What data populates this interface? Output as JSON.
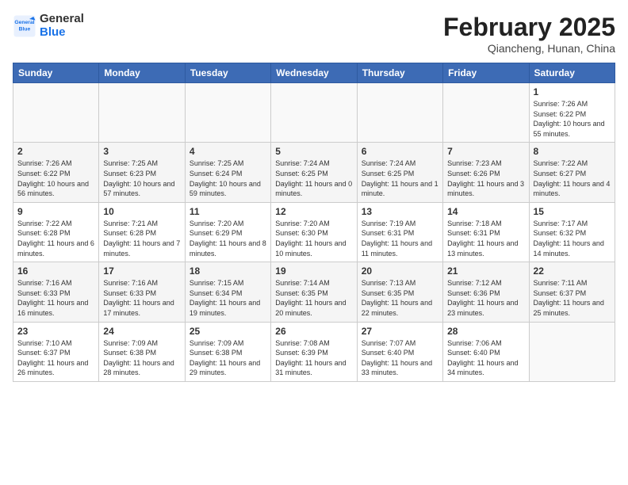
{
  "header": {
    "logo_line1": "General",
    "logo_line2": "Blue",
    "month_title": "February 2025",
    "location": "Qiancheng, Hunan, China"
  },
  "weekdays": [
    "Sunday",
    "Monday",
    "Tuesday",
    "Wednesday",
    "Thursday",
    "Friday",
    "Saturday"
  ],
  "weeks": [
    [
      {
        "day": "",
        "info": ""
      },
      {
        "day": "",
        "info": ""
      },
      {
        "day": "",
        "info": ""
      },
      {
        "day": "",
        "info": ""
      },
      {
        "day": "",
        "info": ""
      },
      {
        "day": "",
        "info": ""
      },
      {
        "day": "1",
        "info": "Sunrise: 7:26 AM\nSunset: 6:22 PM\nDaylight: 10 hours and 55 minutes."
      }
    ],
    [
      {
        "day": "2",
        "info": "Sunrise: 7:26 AM\nSunset: 6:22 PM\nDaylight: 10 hours and 56 minutes."
      },
      {
        "day": "3",
        "info": "Sunrise: 7:25 AM\nSunset: 6:23 PM\nDaylight: 10 hours and 57 minutes."
      },
      {
        "day": "4",
        "info": "Sunrise: 7:25 AM\nSunset: 6:24 PM\nDaylight: 10 hours and 59 minutes."
      },
      {
        "day": "5",
        "info": "Sunrise: 7:24 AM\nSunset: 6:25 PM\nDaylight: 11 hours and 0 minutes."
      },
      {
        "day": "6",
        "info": "Sunrise: 7:24 AM\nSunset: 6:25 PM\nDaylight: 11 hours and 1 minute."
      },
      {
        "day": "7",
        "info": "Sunrise: 7:23 AM\nSunset: 6:26 PM\nDaylight: 11 hours and 3 minutes."
      },
      {
        "day": "8",
        "info": "Sunrise: 7:22 AM\nSunset: 6:27 PM\nDaylight: 11 hours and 4 minutes."
      }
    ],
    [
      {
        "day": "9",
        "info": "Sunrise: 7:22 AM\nSunset: 6:28 PM\nDaylight: 11 hours and 6 minutes."
      },
      {
        "day": "10",
        "info": "Sunrise: 7:21 AM\nSunset: 6:28 PM\nDaylight: 11 hours and 7 minutes."
      },
      {
        "day": "11",
        "info": "Sunrise: 7:20 AM\nSunset: 6:29 PM\nDaylight: 11 hours and 8 minutes."
      },
      {
        "day": "12",
        "info": "Sunrise: 7:20 AM\nSunset: 6:30 PM\nDaylight: 11 hours and 10 minutes."
      },
      {
        "day": "13",
        "info": "Sunrise: 7:19 AM\nSunset: 6:31 PM\nDaylight: 11 hours and 11 minutes."
      },
      {
        "day": "14",
        "info": "Sunrise: 7:18 AM\nSunset: 6:31 PM\nDaylight: 11 hours and 13 minutes."
      },
      {
        "day": "15",
        "info": "Sunrise: 7:17 AM\nSunset: 6:32 PM\nDaylight: 11 hours and 14 minutes."
      }
    ],
    [
      {
        "day": "16",
        "info": "Sunrise: 7:16 AM\nSunset: 6:33 PM\nDaylight: 11 hours and 16 minutes."
      },
      {
        "day": "17",
        "info": "Sunrise: 7:16 AM\nSunset: 6:33 PM\nDaylight: 11 hours and 17 minutes."
      },
      {
        "day": "18",
        "info": "Sunrise: 7:15 AM\nSunset: 6:34 PM\nDaylight: 11 hours and 19 minutes."
      },
      {
        "day": "19",
        "info": "Sunrise: 7:14 AM\nSunset: 6:35 PM\nDaylight: 11 hours and 20 minutes."
      },
      {
        "day": "20",
        "info": "Sunrise: 7:13 AM\nSunset: 6:35 PM\nDaylight: 11 hours and 22 minutes."
      },
      {
        "day": "21",
        "info": "Sunrise: 7:12 AM\nSunset: 6:36 PM\nDaylight: 11 hours and 23 minutes."
      },
      {
        "day": "22",
        "info": "Sunrise: 7:11 AM\nSunset: 6:37 PM\nDaylight: 11 hours and 25 minutes."
      }
    ],
    [
      {
        "day": "23",
        "info": "Sunrise: 7:10 AM\nSunset: 6:37 PM\nDaylight: 11 hours and 26 minutes."
      },
      {
        "day": "24",
        "info": "Sunrise: 7:09 AM\nSunset: 6:38 PM\nDaylight: 11 hours and 28 minutes."
      },
      {
        "day": "25",
        "info": "Sunrise: 7:09 AM\nSunset: 6:38 PM\nDaylight: 11 hours and 29 minutes."
      },
      {
        "day": "26",
        "info": "Sunrise: 7:08 AM\nSunset: 6:39 PM\nDaylight: 11 hours and 31 minutes."
      },
      {
        "day": "27",
        "info": "Sunrise: 7:07 AM\nSunset: 6:40 PM\nDaylight: 11 hours and 33 minutes."
      },
      {
        "day": "28",
        "info": "Sunrise: 7:06 AM\nSunset: 6:40 PM\nDaylight: 11 hours and 34 minutes."
      },
      {
        "day": "",
        "info": ""
      }
    ]
  ]
}
